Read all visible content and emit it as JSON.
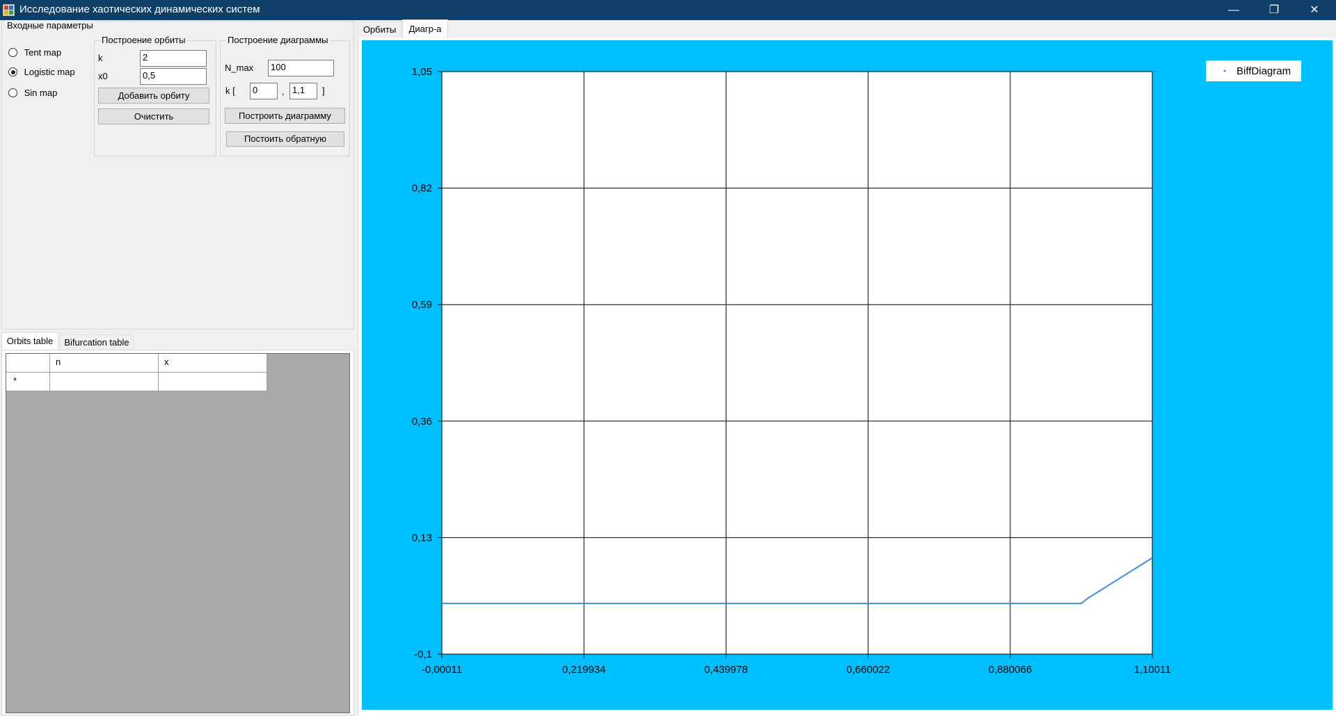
{
  "window": {
    "title": "Исследование хаотических динамических систем",
    "controls": {
      "minimize": "—",
      "maximize": "❐",
      "close": "✕"
    }
  },
  "input_params": {
    "legend": "Входные параметры",
    "maps": [
      {
        "label": "Tent map",
        "selected": false
      },
      {
        "label": "Logistic map",
        "selected": true
      },
      {
        "label": "Sin map",
        "selected": false
      }
    ],
    "orbit": {
      "legend": "Построение орбиты",
      "k_label": "k",
      "k_value": "2",
      "x0_label": "x0",
      "x0_value": "0,5",
      "add_button": "Добавить орбиту",
      "clear_button": "Очистить"
    },
    "diagram": {
      "legend": "Построение диаграммы",
      "nmax_label": "N_max",
      "nmax_value": "100",
      "k_open": "k [",
      "k_from": "0",
      "k_sep": ",",
      "k_to": "1,1",
      "k_close": "]",
      "build_button": "Построить диаграмму",
      "build_inverse_button": "Постоить обратную"
    }
  },
  "bottom_tabs": [
    {
      "label": "Orbits table",
      "active": true
    },
    {
      "label": "Bifurcation table",
      "active": false
    }
  ],
  "orbits_table": {
    "columns": [
      "",
      "n",
      "x"
    ],
    "new_row_marker": "*"
  },
  "right_tabs": [
    {
      "label": "Орбиты",
      "active": false
    },
    {
      "label": "Диагр-а",
      "active": true
    }
  ],
  "colors": {
    "titlebar": "#0f3e66",
    "chart_background": "#00bfff",
    "series_line": "#3d8be0"
  },
  "chart_data": {
    "type": "line",
    "title": "",
    "xlabel": "",
    "ylabel": "",
    "x_ticks": [
      "-0,00011",
      "0,219934",
      "0,439978",
      "0,660022",
      "0,880066",
      "1,10011"
    ],
    "y_ticks": [
      "1,05",
      "0,82",
      "0,59",
      "0,36",
      "0,13",
      "-0,1"
    ],
    "xlim": [
      -0.00011,
      1.10011
    ],
    "ylim": [
      -0.1,
      1.05
    ],
    "grid": true,
    "legend_position": "top-right",
    "series": [
      {
        "name": "BiffDiagram",
        "x": [
          -0.00011,
          0.2,
          0.4,
          0.6,
          0.8,
          0.99,
          1.0,
          1.05,
          1.10011
        ],
        "y": [
          0.0,
          0.0,
          0.0,
          0.0,
          0.0,
          0.0,
          0.01,
          0.05,
          0.09
        ]
      }
    ]
  }
}
